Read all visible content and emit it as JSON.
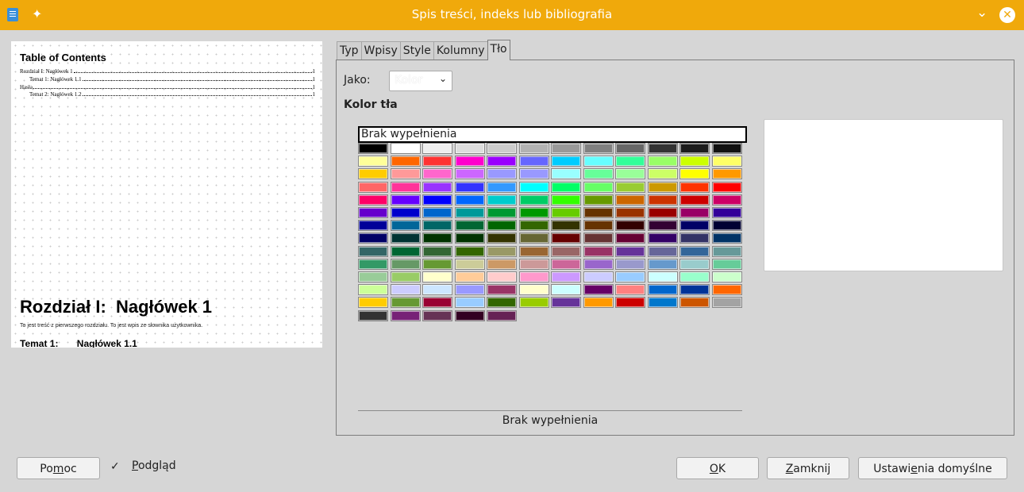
{
  "window": {
    "title": "Spis treści, indeks lub bibliografia",
    "accent": "#f0a90b"
  },
  "preview": {
    "toc_title": "Table of Contents",
    "toc_entries": [
      {
        "text": "Rozdział I: Nagłówek 1",
        "page": "1"
      },
      {
        "text": "Temat 1: Nagłówek 1.1",
        "page": "1"
      },
      {
        "text": "Hasła",
        "page": "1"
      },
      {
        "text": "Temat 2: Nagłówek 1.2",
        "page": "1"
      }
    ],
    "heading1": "Rozdział I:  Nagłówek 1",
    "body": "To jest treść z pierwszego rozdziału. To jest wpis ze słownika użytkownika.",
    "heading2": "Temat 1:       Nagłówek 1.1"
  },
  "tabs": [
    {
      "label": "Typ",
      "active": false
    },
    {
      "label": "Wpisy",
      "active": false
    },
    {
      "label": "Style",
      "active": false
    },
    {
      "label": "Kolumny",
      "active": false
    },
    {
      "label": "Tło",
      "active": true
    }
  ],
  "background": {
    "as_label": "Jako:",
    "as_value": "Kolor",
    "section_title": "Kolor tła",
    "no_fill": "Brak wypełnienia",
    "current_fill": "Brak wypełnienia",
    "palette": [
      [
        "#000000",
        "#ffffff",
        "#eeeeee",
        "#dddddd",
        "#cccccc",
        "#b2b2b2",
        "#999999",
        "#808080",
        "#666666",
        "#333333",
        "#1c1c1c",
        "#111111"
      ],
      [
        "#ffff99",
        "#ff6600",
        "#ff3333",
        "#ff00cc",
        "#9900ff",
        "#6666ff",
        "#00ccff",
        "#66ffff",
        "#33ff99",
        "#99ff66",
        "#ccff00",
        "#ffff66"
      ],
      [
        "#ffcc00",
        "#ff9999",
        "#ff66cc",
        "#cc66ff",
        "#9999ff",
        "#9999ff",
        "#99ffff",
        "#66ff99",
        "#99ff99",
        "#ccff66",
        "#ffff00",
        "#ff9900"
      ],
      [
        "#ff6666",
        "#ff3399",
        "#9933ff",
        "#3333ff",
        "#3399ff",
        "#00ffff",
        "#00ff66",
        "#66ff66",
        "#99cc33",
        "#cc9900",
        "#ff3300",
        "#ff0000"
      ],
      [
        "#ff0066",
        "#6600ff",
        "#0000ff",
        "#0066ff",
        "#00cccc",
        "#00cc66",
        "#33ff00",
        "#669900",
        "#cc6600",
        "#cc3300",
        "#cc0000",
        "#cc0066"
      ],
      [
        "#6600cc",
        "#0000cc",
        "#0066cc",
        "#009999",
        "#009933",
        "#009900",
        "#66cc00",
        "#663300",
        "#993300",
        "#990000",
        "#990066",
        "#330099"
      ],
      [
        "#000099",
        "#006699",
        "#006666",
        "#006633",
        "#006600",
        "#336600",
        "#333300",
        "#663300",
        "#330000",
        "#330033",
        "#000066",
        "#000033"
      ],
      [
        "#000066",
        "#003333",
        "#003300",
        "#003300",
        "#333300",
        "#666633",
        "#660000",
        "#663333",
        "#660033",
        "#330066",
        "#333366",
        "#003366"
      ],
      [
        "#336666",
        "#006633",
        "#336633",
        "#336600",
        "#999966",
        "#996633",
        "#996666",
        "#993366",
        "#663399",
        "#666699",
        "#336699",
        "#669999"
      ],
      [
        "#339966",
        "#669966",
        "#669933",
        "#cccc99",
        "#cc9966",
        "#cc9999",
        "#cc6699",
        "#9966cc",
        "#9999cc",
        "#6699cc",
        "#99cccc",
        "#66cc99"
      ],
      [
        "#99cc99",
        "#99cc66",
        "#ffffcc",
        "#ffcc99",
        "#ffcccc",
        "#ff99cc",
        "#cc99ff",
        "#ccccff",
        "#99ccff",
        "#ccffff",
        "#99ffcc",
        "#ccffcc"
      ],
      [
        "#ccff99",
        "#ccccff",
        "#cce6ff",
        "#9999ff",
        "#993366",
        "#ffffcc",
        "#ccffff",
        "#660066",
        "#ff8080",
        "#0066cc",
        "#003399",
        "#ff6600"
      ],
      [
        "#ffcc00",
        "#669933",
        "#990033",
        "#99ccff",
        "#336600",
        "#99cc00",
        "#663399",
        "#ff9900",
        "#cc0000",
        "#0077cc",
        "#cc5500",
        "#a3a3a3"
      ],
      [
        "#333333",
        "#772277",
        "#663355",
        "#330022",
        "#662255"
      ]
    ]
  },
  "buttons": {
    "help_pre": "Po",
    "help_mn": "m",
    "help_post": "oc",
    "preview_mn": "P",
    "preview_post": "odgląd",
    "preview_checked": "✓",
    "ok_mn": "O",
    "ok_post": "K",
    "close_mn": "Z",
    "close_post": "amknij",
    "defaults_pre": "Ustawi",
    "defaults_mn": "e",
    "defaults_post": "nia domyślne"
  },
  "icons": {
    "pin": "✦",
    "chevron": "⌄",
    "close": "✕",
    "dropdown": "⌄"
  }
}
